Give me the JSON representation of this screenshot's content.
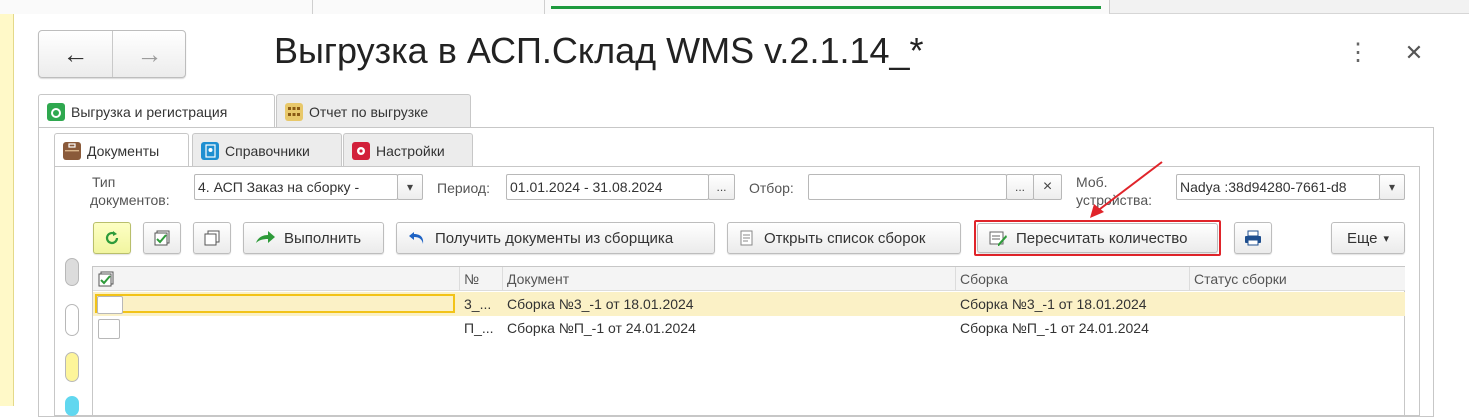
{
  "window": {
    "title": "Выгрузка в АСП.Склад WMS v.2.1.14_*",
    "back_icon": "←",
    "forward_icon": "→",
    "menu_icon": "⋮",
    "close_icon": "✕"
  },
  "outer_tabs": [
    {
      "label": "Выгрузка и регистрация",
      "icon": "green-export-icon"
    },
    {
      "label": "Отчет по выгрузке",
      "icon": "report-icon"
    }
  ],
  "inner_tabs": [
    {
      "label": "Документы",
      "icon": "briefcase-icon"
    },
    {
      "label": "Справочники",
      "icon": "directory-book-icon"
    },
    {
      "label": "Настройки",
      "icon": "settings-icon"
    }
  ],
  "filters": {
    "doc_type_label_1": "Тип",
    "doc_type_label_2": "документов:",
    "doc_type_value": "4. АСП Заказ на сборку -",
    "period_label": "Период:",
    "period_value": "01.01.2024 - 31.08.2024",
    "filter_label": "Отбор:",
    "filter_value": "",
    "ellipsis": "...",
    "clear": "×",
    "dropdown": "▾",
    "device_label_1": "Моб.",
    "device_label_2": "устройства:",
    "device_value": "Nadya :38d94280-7661-d8"
  },
  "toolbar": {
    "execute_label": "Выполнить",
    "get_docs_label": "Получить документы из сборщика",
    "open_list_label": "Открыть список сборок",
    "recalc_label": "Пересчитать количество",
    "more_label": "Еще",
    "more_arrow": "▾"
  },
  "table": {
    "columns": [
      "№",
      "Документ",
      "Сборка",
      "Статус сборки"
    ],
    "rows": [
      {
        "num": "3_...",
        "document": "Сборка №3_-1 от 18.01.2024",
        "assembly": "Сборка №3_-1 от 18.01.2024",
        "status": ""
      },
      {
        "num": "П_...",
        "document": "Сборка №П_-1 от 24.01.2024",
        "assembly": "Сборка №П_-1 от 24.01.2024",
        "status": ""
      }
    ]
  },
  "colors": {
    "accent_green": "#1e9a3e",
    "highlight_red": "#e0242a",
    "selected_row": "#fbf1c6",
    "refresh_button": "#f1f5a0"
  }
}
